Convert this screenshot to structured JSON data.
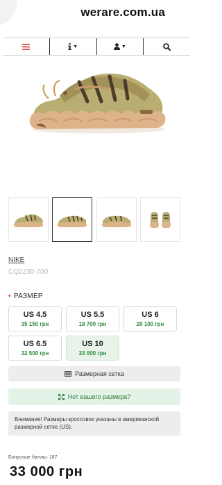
{
  "header": {
    "site_title": "werare.com.ua"
  },
  "navbar": {
    "items": [
      {
        "icon": "hamburger-menu-icon",
        "color": "#e24a4a"
      },
      {
        "icon": "info-icon"
      },
      {
        "icon": "user-icon"
      },
      {
        "icon": "search-icon"
      }
    ]
  },
  "product": {
    "brand": "NIKE",
    "sku": "CQ2230-700",
    "size_label": "РАЗМЕР",
    "sizes": [
      {
        "size": "US 4.5",
        "price": "35 150 грн",
        "selected": false
      },
      {
        "size": "US 5.5",
        "price": "18 700 грн",
        "selected": false
      },
      {
        "size": "US 6",
        "price": "20 100 грн",
        "selected": false
      },
      {
        "size": "US 6.5",
        "price": "32 500 грн",
        "selected": false
      },
      {
        "size": "US 10",
        "price": "33 000 грн",
        "selected": true
      }
    ],
    "size_chart_label": "Размерная сетка",
    "no_size_label": "Нет вашего размера?",
    "notice": "Внимание! Размеры кроссовок указаны в американской размерной сетке (US).",
    "bonus": "Бонусные баллы: 187",
    "price": "33 000 грн"
  },
  "colors": {
    "accent_green": "#2e8b3d",
    "selected_bg": "#e8f4ea",
    "menu_red": "#e24a4a"
  }
}
